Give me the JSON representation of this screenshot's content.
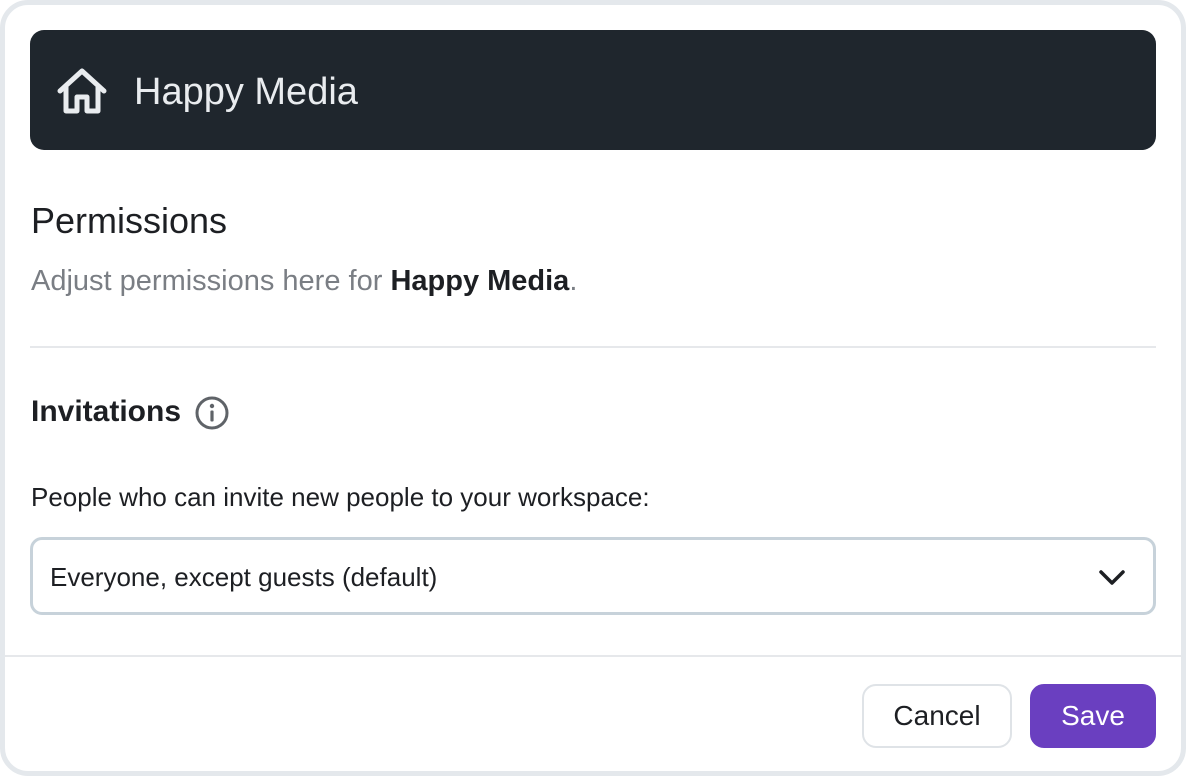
{
  "header": {
    "workspace_name": "Happy Media",
    "icon": "home-icon",
    "background_color": "#1f262d"
  },
  "main": {
    "title": "Permissions",
    "subtitle_prefix": "Adjust permissions here for ",
    "subtitle_bold": "Happy Media",
    "subtitle_suffix": "."
  },
  "invitations": {
    "section_title": "Invitations",
    "info_icon": "info-icon",
    "field_label": "People who can invite new people to your workspace:",
    "selected_value": "Everyone, except guests (default)",
    "dropdown_icon": "chevron-down-icon"
  },
  "footer": {
    "cancel_label": "Cancel",
    "save_label": "Save",
    "save_color": "#6a3fc0"
  }
}
